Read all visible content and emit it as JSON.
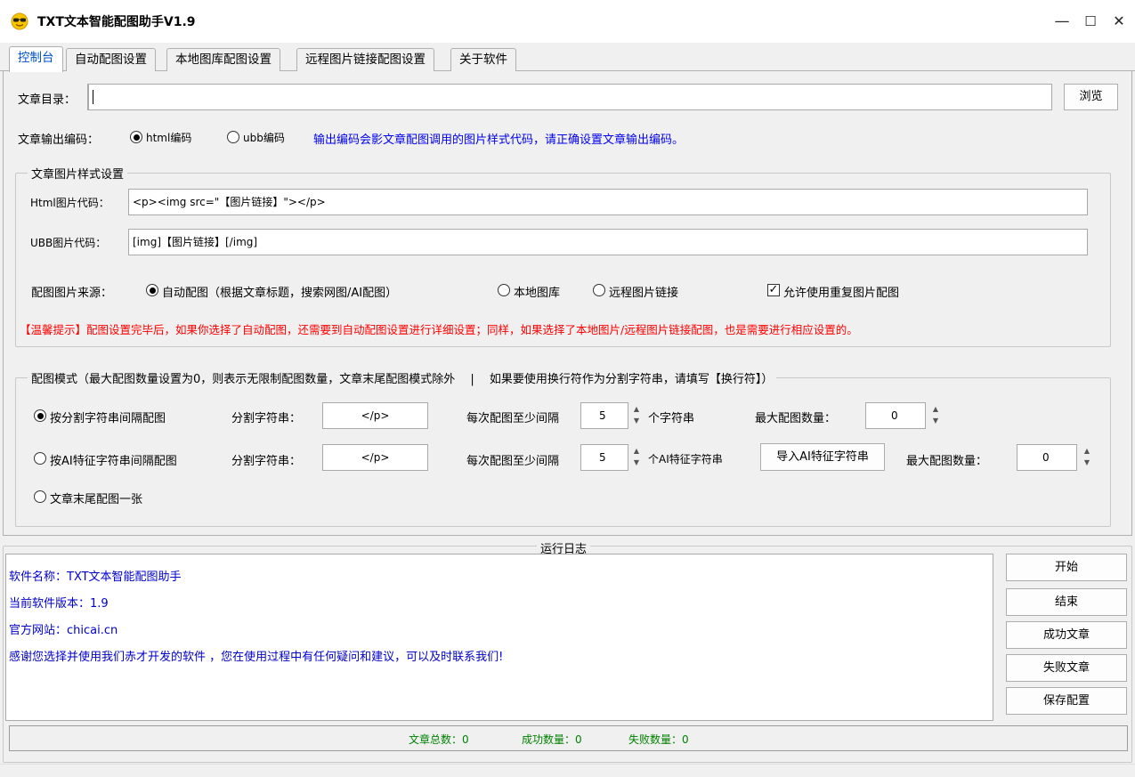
{
  "window": {
    "title": "TXT文本智能配图助手V1.9",
    "icon": "sunglasses-face-icon",
    "minimize": "—",
    "maximize": "☐",
    "close": "✕"
  },
  "tabs": [
    {
      "label": "控制台",
      "active": true
    },
    {
      "label": "自动配图设置"
    },
    {
      "label": "本地图库配图设置"
    },
    {
      "label": "远程图片链接配图设置"
    },
    {
      "label": "关于软件"
    }
  ],
  "article_dir": {
    "label": "文章目录：",
    "value": "",
    "browse_label": "浏览"
  },
  "encoding": {
    "label": "文章输出编码：",
    "options": [
      {
        "label": "html编码",
        "selected": true
      },
      {
        "label": "ubb编码",
        "selected": false
      }
    ],
    "hint": "输出编码会影文章配图调用的图片样式代码，请正确设置文章输出编码。"
  },
  "style_group": {
    "title": "文章图片样式设置",
    "html_label": "Html图片代码：",
    "html_value": "<p><img src=\"【图片链接】\"></p>",
    "ubb_label": "UBB图片代码：",
    "ubb_value": "[img]【图片链接】[/img]",
    "source_label": "配图图片来源：",
    "source_options": [
      {
        "label": "自动配图（根据文章标题，搜索网图/AI配图）",
        "selected": true
      },
      {
        "label": "本地图库",
        "selected": false
      },
      {
        "label": "远程图片链接",
        "selected": false
      }
    ],
    "allow_repeat": {
      "label": "允许使用重复图片配图",
      "checked": true
    },
    "tip": "【温馨提示】配图设置完毕后，如果你选择了自动配图，还需要到自动配图设置进行详细设置；同样，如果选择了本地图片/远程图片链接配图，也是需要进行相应设置的。"
  },
  "mode_group": {
    "title": "配图模式（最大配图数量设置为0，则表示无限制配图数量，文章末尾配图模式除外　 |　 如果要使用换行符作为分割字符串，请填写【换行符】）",
    "row1": {
      "radio_label": "按分割字符串间隔配图",
      "selected": true,
      "sep_label": "分割字符串：",
      "sep_value": "</p>",
      "interval_label": "每次配图至少间隔",
      "interval_value": "5",
      "unit": "个字符串",
      "max_label": "最大配图数量：",
      "max_value": "0"
    },
    "row2": {
      "radio_label": "按AI特征字符串间隔配图",
      "selected": false,
      "sep_label": "分割字符串：",
      "sep_value": "</p>",
      "interval_label": "每次配图至少间隔",
      "interval_value": "5",
      "unit": "个AI特征字符串",
      "import_label": "导入AI特征字符串",
      "max_label": "最大配图数量：",
      "max_value": "0"
    },
    "row3": {
      "radio_label": "文章末尾配图一张",
      "selected": false
    }
  },
  "log": {
    "title": "运行日志",
    "lines": [
      "软件名称：TXT文本智能配图助手",
      "当前软件版本：1.9",
      "官方网站：chicai.cn",
      "感谢您选择并使用我们赤才开发的软件 ，您在使用过程中有任何疑问和建议，可以及时联系我们!"
    ]
  },
  "actions": [
    "开始",
    "结束",
    "成功文章",
    "失败文章",
    "保存配置"
  ],
  "status": {
    "total": "文章总数：0",
    "success": "成功数量：0",
    "fail": "失败数量：0"
  }
}
